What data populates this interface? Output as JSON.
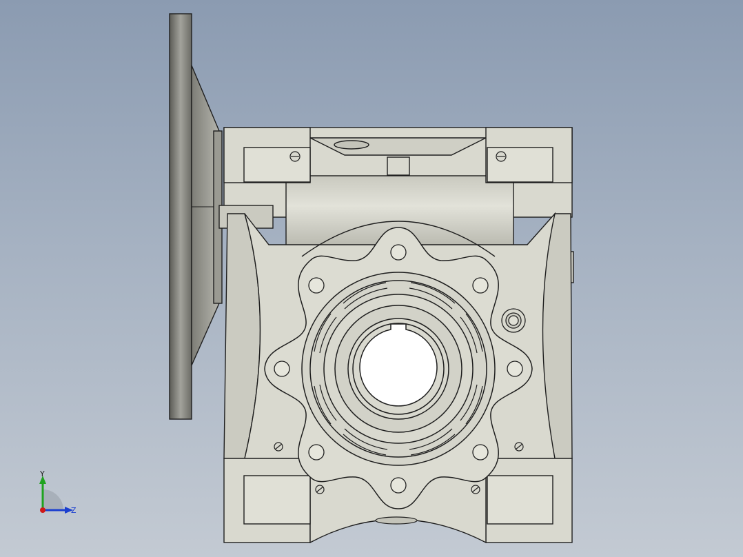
{
  "viewport": {
    "name": "cad-graphics-area"
  },
  "triad": {
    "y_label": "Y",
    "z_label": "Z",
    "colors": {
      "y": "#1fa31f",
      "z": "#1b3fcf",
      "x": "#d01818"
    }
  },
  "model": {
    "part": "worm-gearbox",
    "colors": {
      "housing": "#d9d9cf",
      "housing_shadow": "#b8b8ae",
      "flange": "#8f8f88",
      "flange_dark": "#5f5f5a",
      "edge": "#1e1e1e",
      "bore": "#ffffff"
    }
  }
}
